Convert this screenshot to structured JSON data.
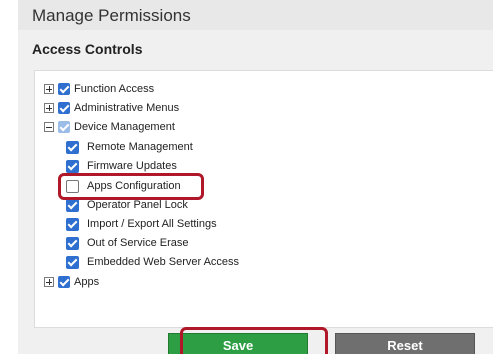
{
  "header": {
    "title": "Manage Permissions"
  },
  "section": {
    "title": "Access Controls"
  },
  "tree": {
    "function_access": {
      "label": "Function Access",
      "expanded": false,
      "checked": true
    },
    "administrative_menus": {
      "label": "Administrative Menus",
      "expanded": false,
      "checked": true
    },
    "device_management": {
      "label": "Device Management",
      "expanded": true,
      "checked": "partial",
      "children": [
        {
          "label": "Remote Management",
          "checked": true
        },
        {
          "label": "Firmware Updates",
          "checked": true
        },
        {
          "label": "Apps Configuration",
          "checked": false
        },
        {
          "label": "Operator Panel Lock",
          "checked": true
        },
        {
          "label": "Import / Export All Settings",
          "checked": true
        },
        {
          "label": "Out of Service Erase",
          "checked": true
        },
        {
          "label": "Embedded Web Server Access",
          "checked": true
        }
      ]
    },
    "apps": {
      "label": "Apps",
      "expanded": false,
      "checked": true
    }
  },
  "buttons": {
    "save": "Save",
    "reset": "Reset"
  },
  "colors": {
    "checkbox": "#2e6fd0",
    "save": "#2e9e45",
    "reset": "#6f6f6f",
    "highlight": "#b0182a"
  }
}
